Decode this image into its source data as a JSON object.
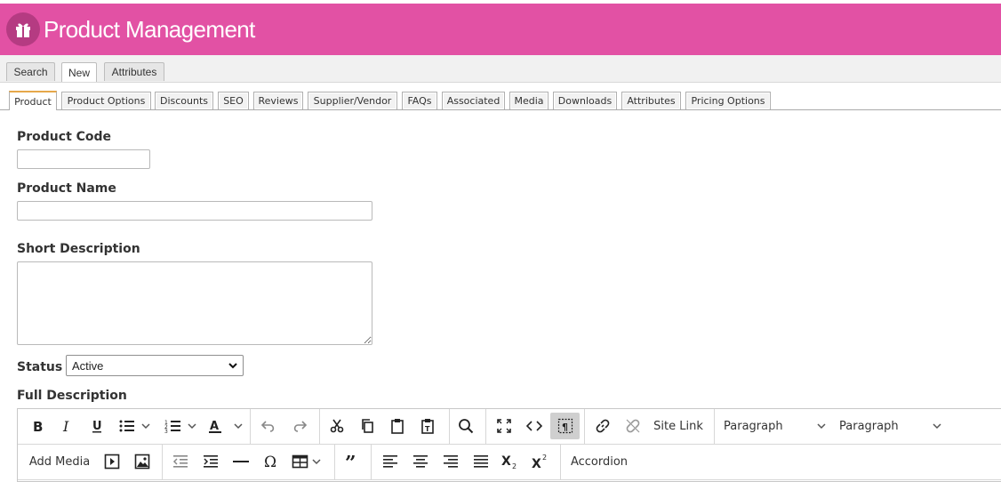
{
  "header": {
    "title": "Product Management",
    "icon": "gift-icon",
    "background": "#e251a4"
  },
  "main_tabs": [
    {
      "label": "Search"
    },
    {
      "label": "New",
      "active": true
    },
    {
      "label": "Attributes"
    }
  ],
  "sub_tabs": [
    {
      "label": "Product",
      "active": true
    },
    {
      "label": "Product Options"
    },
    {
      "label": "Discounts"
    },
    {
      "label": "SEO"
    },
    {
      "label": "Reviews"
    },
    {
      "label": "Supplier/Vendor"
    },
    {
      "label": "FAQs"
    },
    {
      "label": "Associated"
    },
    {
      "label": "Media"
    },
    {
      "label": "Downloads"
    },
    {
      "label": "Attributes"
    },
    {
      "label": "Pricing Options"
    }
  ],
  "form": {
    "product_code_label": "Product Code",
    "product_code_value": "",
    "product_name_label": "Product Name",
    "product_name_value": "",
    "short_description_label": "Short Description",
    "short_description_value": "",
    "status_label": "Status",
    "status_value": "Active",
    "full_description_label": "Full Description"
  },
  "editor": {
    "row1": {
      "site_link": "Site Link",
      "paragraph_1": "Paragraph",
      "paragraph_2": "Paragraph"
    },
    "row2": {
      "add_media": "Add Media",
      "accordion": "Accordion"
    }
  }
}
